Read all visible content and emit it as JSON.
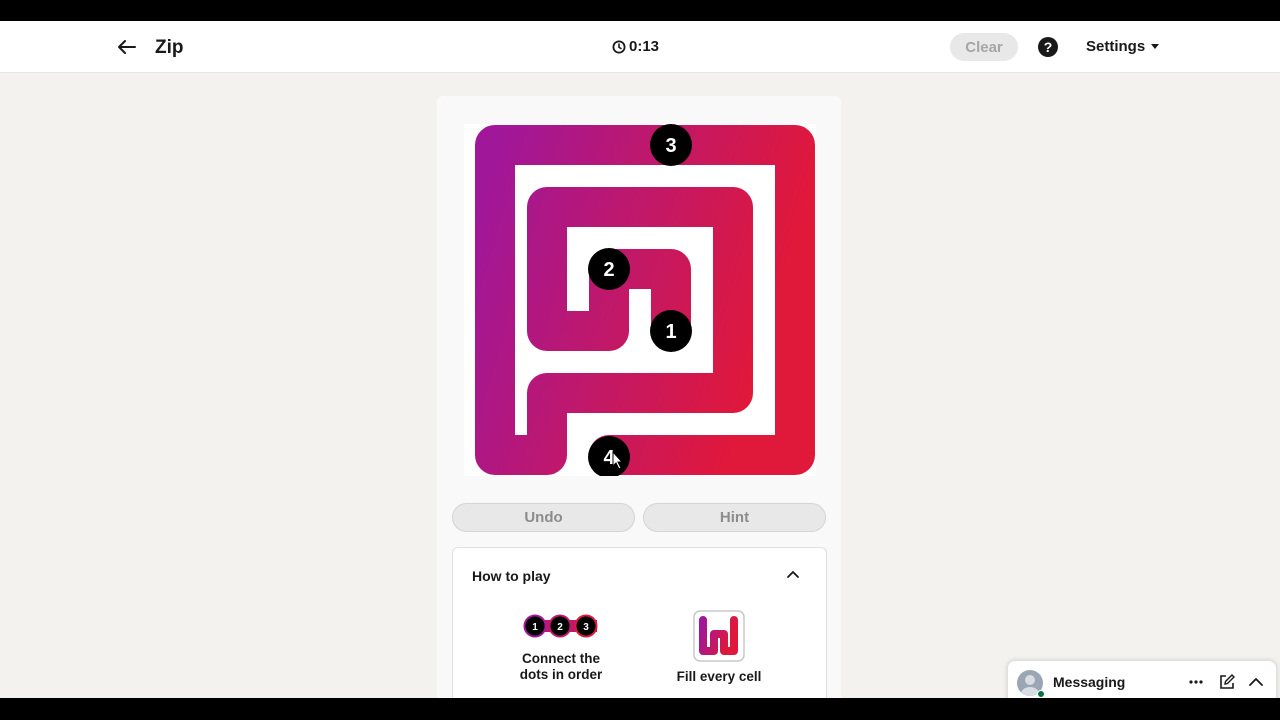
{
  "header": {
    "title": "Zip",
    "timer": "0:13",
    "clear_label": "Clear",
    "help_label": "?",
    "settings_label": "Settings"
  },
  "puzzle": {
    "grid_size": 6,
    "path_color_start": "#a0179a",
    "path_color_end": "#e0183a",
    "dots": [
      {
        "label": "1"
      },
      {
        "label": "2"
      },
      {
        "label": "3"
      },
      {
        "label": "4"
      }
    ]
  },
  "controls": {
    "undo_label": "Undo",
    "hint_label": "Hint"
  },
  "how_to_play": {
    "title": "How to play",
    "tips": [
      {
        "label": "Connect the dots in order",
        "line1": "Connect the",
        "line2": "dots in order",
        "dots": [
          "1",
          "2",
          "3"
        ]
      },
      {
        "label": "Fill every cell"
      }
    ]
  },
  "messaging": {
    "label": "Messaging"
  }
}
